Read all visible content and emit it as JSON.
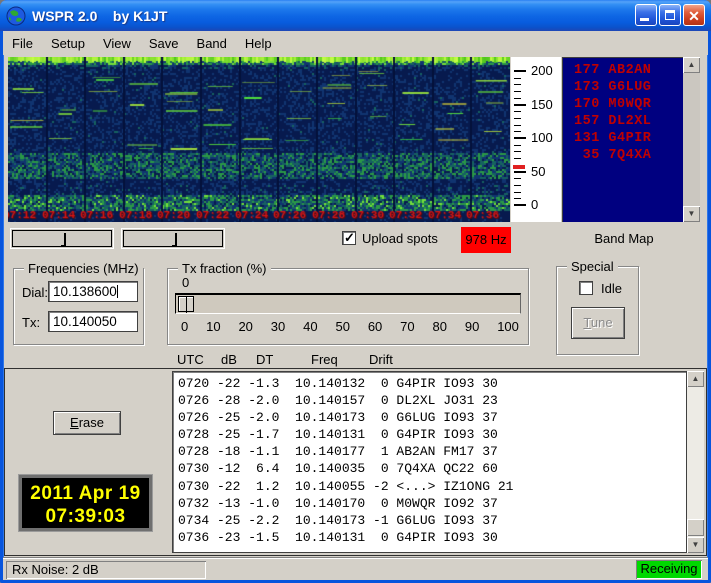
{
  "window": {
    "title": "WSPR 2.0    by K1JT"
  },
  "menu": {
    "items": [
      "File",
      "Setup",
      "View",
      "Save",
      "Band",
      "Help"
    ]
  },
  "waterfall": {
    "time_labels": [
      "07:12",
      "07:14",
      "07:16",
      "07:18",
      "07:20",
      "07:22",
      "07:24",
      "07:26",
      "07:28",
      "07:30",
      "07:32",
      "07:34",
      "07:36"
    ]
  },
  "scale": {
    "major_ticks": [
      "200",
      "150",
      "100",
      "50",
      "0"
    ],
    "marker_value": 57,
    "marker_color": "#E02020"
  },
  "band_map": {
    "title": "Band Map",
    "bg": "#000080",
    "fg": "#C00000",
    "entries": [
      "177 AB2AN",
      "173 G6LUG",
      "170 M0WQR",
      "157 DL2XL",
      "131 G4PIR",
      " 35 7Q4XA"
    ]
  },
  "controls": {
    "upload_spots": {
      "label": "Upload spots",
      "checked": true
    },
    "rx_freq_badge": {
      "text": "978 Hz",
      "bg": "#FF0000"
    }
  },
  "frequencies": {
    "title": "Frequencies (MHz)",
    "dial_label": "Dial:",
    "dial_value": "10.138600",
    "tx_label": "Tx:",
    "tx_value": "10.140050"
  },
  "tx_fraction": {
    "title": "Tx fraction (%)",
    "value": "0",
    "scale_labels": [
      "0",
      "10",
      "20",
      "30",
      "40",
      "50",
      "60",
      "70",
      "80",
      "90",
      "100"
    ]
  },
  "special": {
    "title": "Special",
    "idle": {
      "label": "Idle",
      "checked": false
    },
    "tune_label": "Tune"
  },
  "spots": {
    "headers": [
      "UTC",
      "dB",
      "DT",
      "Freq",
      "Drift"
    ],
    "rows": [
      "0720 -22 -1.3  10.140132  0 G4PIR IO93 30",
      "0726 -28 -2.0  10.140157  0 DL2XL JO31 23",
      "0726 -25 -2.0  10.140173  0 G6LUG IO93 37",
      "0728 -25 -1.7  10.140131  0 G4PIR IO93 30",
      "0728 -18 -1.1  10.140177  1 AB2AN FM17 37",
      "0730 -12  6.4  10.140035  0 7Q4XA QC22 60",
      "0730 -22  1.2  10.140055 -2 <...> IZ1ONG 21",
      "0732 -13 -1.0  10.140170  0 M0WQR IO92 37",
      "0734 -25 -2.2  10.140173 -1 G6LUG IO93 37",
      "0736 -23 -1.5  10.140131  0 G4PIR IO93 30"
    ]
  },
  "erase_label": "Erase",
  "clock": {
    "date": "2011 Apr 19",
    "time": "07:39:03"
  },
  "status": {
    "rx_noise": "Rx Noise: 2 dB",
    "mode": "Receiving"
  }
}
